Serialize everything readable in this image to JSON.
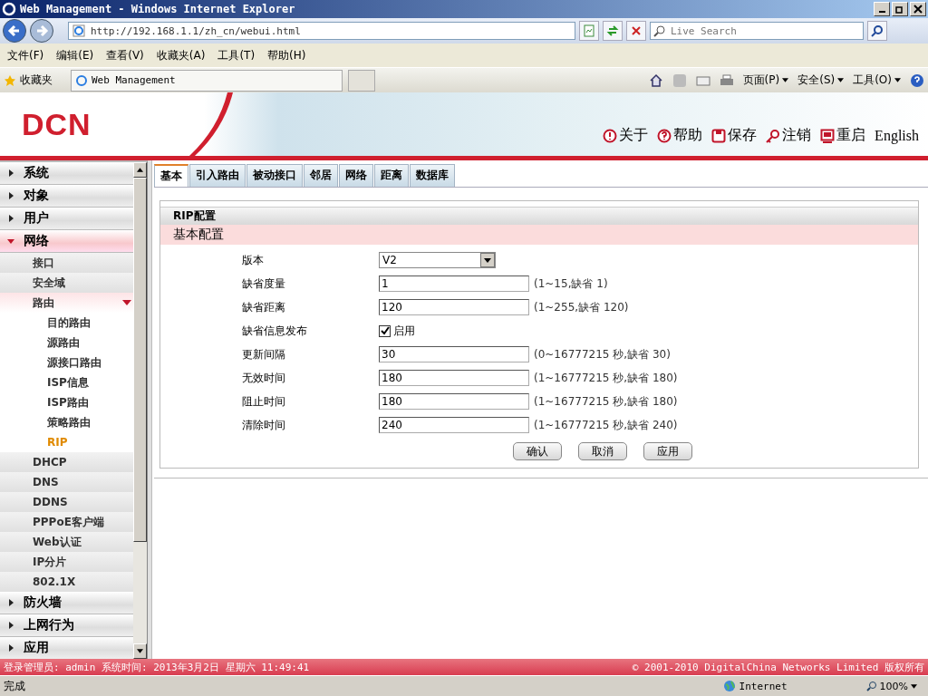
{
  "window": {
    "title": "Web Management - Windows Internet Explorer"
  },
  "address_bar": {
    "value": "http://192.168.1.1/zh_cn/webui.html"
  },
  "search": {
    "placeholder": "Live Search"
  },
  "menu": [
    "文件(F)",
    "编辑(E)",
    "查看(V)",
    "收藏夹(A)",
    "工具(T)",
    "帮助(H)"
  ],
  "favorites": {
    "label": "收藏夹",
    "tab": "Web Management",
    "commands": [
      "页面(P)",
      "安全(S)",
      "工具(O)"
    ]
  },
  "header": {
    "logo": "DCN",
    "links": [
      {
        "label": "关于"
      },
      {
        "label": "帮助"
      },
      {
        "label": "保存"
      },
      {
        "label": "注销"
      },
      {
        "label": "重启"
      },
      {
        "label": "English"
      }
    ]
  },
  "sidebar": {
    "items": [
      {
        "label": "系统",
        "expanded": false
      },
      {
        "label": "对象",
        "expanded": false
      },
      {
        "label": "用户",
        "expanded": false
      },
      {
        "label": "网络",
        "expanded": true,
        "children": [
          {
            "label": "接口",
            "selected": false
          },
          {
            "label": "安全域",
            "selected": false
          },
          {
            "label": "路由",
            "selected": false,
            "expanded": true,
            "children": [
              {
                "label": "目的路由",
                "selected": false
              },
              {
                "label": "源路由",
                "selected": false
              },
              {
                "label": "源接口路由",
                "selected": false
              },
              {
                "label": "ISP信息",
                "selected": false
              },
              {
                "label": "ISP路由",
                "selected": false
              },
              {
                "label": "策略路由",
                "selected": false
              },
              {
                "label": "RIP",
                "selected": true
              }
            ]
          },
          {
            "label": "DHCP",
            "selected": false
          },
          {
            "label": "DNS",
            "selected": false
          },
          {
            "label": "DDNS",
            "selected": false
          },
          {
            "label": "PPPoE客户端",
            "selected": false
          },
          {
            "label": "Web认证",
            "selected": false
          },
          {
            "label": "IP分片",
            "selected": false
          },
          {
            "label": "802.1X",
            "selected": false
          }
        ]
      },
      {
        "label": "防火墙",
        "expanded": false
      },
      {
        "label": "上网行为",
        "expanded": false
      },
      {
        "label": "应用",
        "expanded": false
      }
    ]
  },
  "tabs": [
    {
      "label": "基本",
      "selected": true
    },
    {
      "label": "引入路由",
      "selected": false
    },
    {
      "label": "被动接口",
      "selected": false
    },
    {
      "label": "邻居",
      "selected": false
    },
    {
      "label": "网络",
      "selected": false
    },
    {
      "label": "距离",
      "selected": false
    },
    {
      "label": "数据库",
      "selected": false
    }
  ],
  "panel": {
    "title": "RIP配置",
    "section": "基本配置",
    "fields": [
      {
        "kind": "select",
        "label": "版本",
        "value": "V2"
      },
      {
        "kind": "text",
        "label": "缺省度量",
        "value": "1",
        "hint": "(1~15,缺省 1)"
      },
      {
        "kind": "text",
        "label": "缺省距离",
        "value": "120",
        "hint": "(1~255,缺省 120)"
      },
      {
        "kind": "checkbox",
        "label": "缺省信息发布",
        "checked": true,
        "text": "启用"
      },
      {
        "kind": "text",
        "label": "更新间隔",
        "value": "30",
        "hint": "(0~16777215 秒,缺省 30)"
      },
      {
        "kind": "text",
        "label": "无效时间",
        "value": "180",
        "hint": "(1~16777215 秒,缺省 180)"
      },
      {
        "kind": "text",
        "label": "阻止时间",
        "value": "180",
        "hint": "(1~16777215 秒,缺省 180)"
      },
      {
        "kind": "text",
        "label": "清除时间",
        "value": "240",
        "hint": "(1~16777215 秒,缺省 240)"
      }
    ],
    "buttons": [
      "确认",
      "取消",
      "应用"
    ]
  },
  "footer": {
    "left": "登录管理员: admin 系统时间: 2013年3月2日 星期六 11:49:41",
    "right": "© 2001-2010 DigitalChina Networks Limited 版权所有"
  },
  "status_bar": {
    "text": "完成",
    "zone": "Internet",
    "zoom": "100%"
  }
}
